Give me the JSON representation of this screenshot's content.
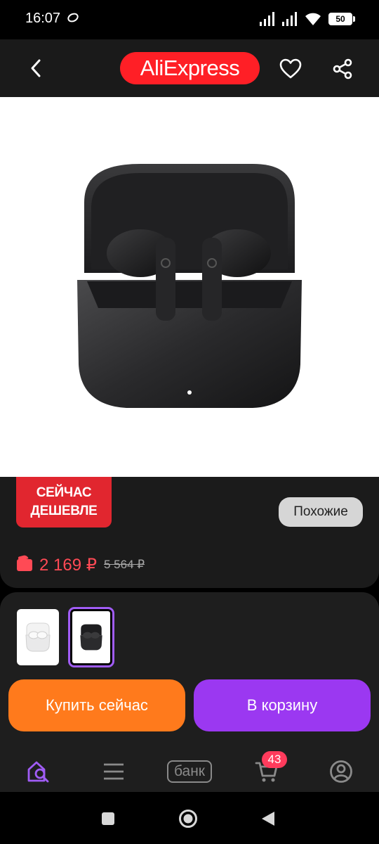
{
  "status_bar": {
    "time": "16:07",
    "battery": "50",
    "icons": [
      "signal-icon",
      "signal-icon",
      "wifi-icon",
      "battery-icon"
    ]
  },
  "top_nav": {
    "logo_text": "AliExpress",
    "back_icon": "chevron-left-icon",
    "favorite_icon": "heart-icon",
    "share_icon": "share-icon"
  },
  "product": {
    "image": "black wireless earbuds in open charging case",
    "deal_badge": {
      "line1": "СЕЙЧАС",
      "line2": "ДЕШЕВЛЕ"
    },
    "similar_label": "Похожие",
    "price_current": "2 169 ₽",
    "price_old": "5 564 ₽"
  },
  "variants": [
    {
      "name": "white",
      "selected": false
    },
    {
      "name": "black",
      "selected": true
    }
  ],
  "actions": {
    "buy_now": "Купить сейчас",
    "add_to_cart": "В корзину"
  },
  "tab_bar": {
    "items": [
      {
        "name": "home-search",
        "icon": "home-search-icon",
        "active": true
      },
      {
        "name": "catalog",
        "icon": "menu-icon",
        "active": false
      },
      {
        "name": "bank",
        "label": "банк",
        "active": false
      },
      {
        "name": "cart",
        "icon": "cart-icon",
        "badge": "43",
        "active": false
      },
      {
        "name": "profile",
        "icon": "profile-icon",
        "active": false
      }
    ]
  },
  "system_nav": [
    "recents-icon",
    "home-icon",
    "back-icon"
  ],
  "colors": {
    "brand_red": "#ff1f26",
    "deal_red": "#e1262f",
    "price_red": "#ff4a55",
    "buy_orange": "#ff7a1c",
    "cart_purple": "#9b38f1",
    "active_tab": "#a05cf5"
  }
}
